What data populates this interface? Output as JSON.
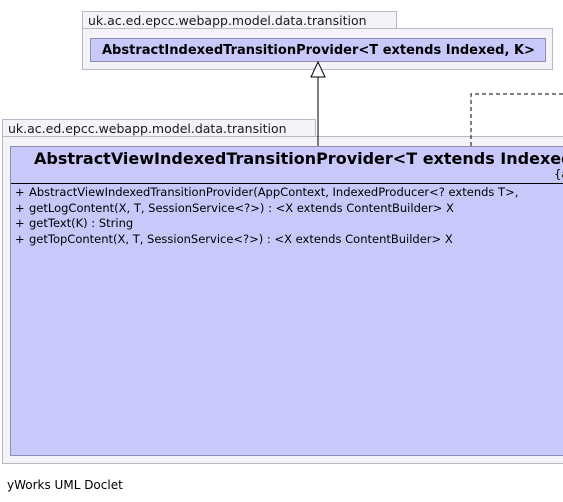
{
  "parent_package": {
    "name": "uk.ac.ed.epcc.webapp.model.data.transition",
    "class": {
      "name": "AbstractIndexedTransitionProvider<T extends Indexed, K>"
    }
  },
  "child_package": {
    "name": "uk.ac.ed.epcc.webapp.model.data.transition",
    "class": {
      "name": "AbstractViewIndexedTransitionProvider<T extends Indexed",
      "stereotype_fragment": "{a",
      "methods": [
        {
          "visibility": "+",
          "signature": "AbstractViewIndexedTransitionProvider(AppContext, IndexedProducer<? extends T>,"
        },
        {
          "visibility": "+",
          "signature": "getLogContent(X, T, SessionService<?>) : <X extends ContentBuilder> X"
        },
        {
          "visibility": "+",
          "signature": "getText(K) : String"
        },
        {
          "visibility": "+",
          "signature": "getTopContent(X, T, SessionService<?>) : <X extends ContentBuilder> X"
        }
      ]
    }
  },
  "relations": [
    {
      "kind": "generalization",
      "from": "AbstractViewIndexedTransitionProvider",
      "to": "AbstractIndexedTransitionProvider"
    },
    {
      "kind": "dependency",
      "style": "dashed"
    }
  ],
  "caption": "yWorks UML Doclet"
}
